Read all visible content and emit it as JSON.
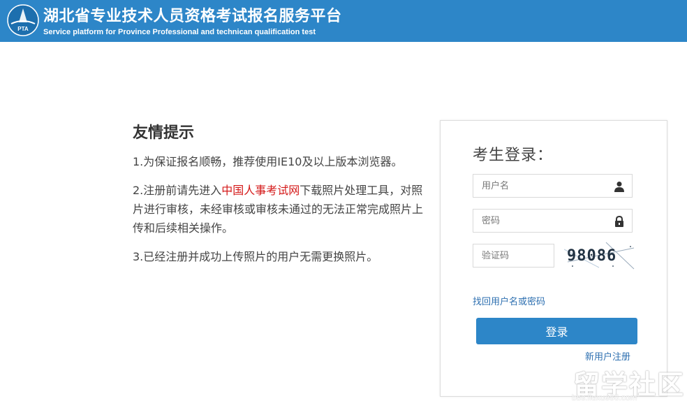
{
  "header": {
    "title": "湖北省专业技术人员资格考试报名服务平台",
    "subtitle": "Service platform for Province Professional and technican qualification test",
    "logo_text": "PTA",
    "background_color": "#2d86c8"
  },
  "tips": {
    "heading": "友情提示",
    "item1": "1.为保证报名顺畅，推荐使用IE10及以上版本浏览器。",
    "item2_prefix": "2.注册前请先进入",
    "item2_link": "中国人事考试网",
    "item2_suffix": "下载照片处理工具，对照片进行审核，未经审核或审核未通过的无法正常完成照片上传和后续相关操作。",
    "item3": "3.已经注册并成功上传照片的用户无需更换照片。",
    "link_color": "#d41818"
  },
  "login": {
    "title": "考生登录：",
    "username_placeholder": "用户名",
    "username_icon": "user-icon",
    "password_placeholder": "密码",
    "password_icon": "lock-icon",
    "captcha_placeholder": "验证码",
    "captcha_code": "98086",
    "forgot_link": "找回用户名或密码",
    "login_button": "登录",
    "register_link": "新用户注册"
  },
  "watermark": {
    "text": "留学社区",
    "url": "bbs.liuxue86.com"
  }
}
